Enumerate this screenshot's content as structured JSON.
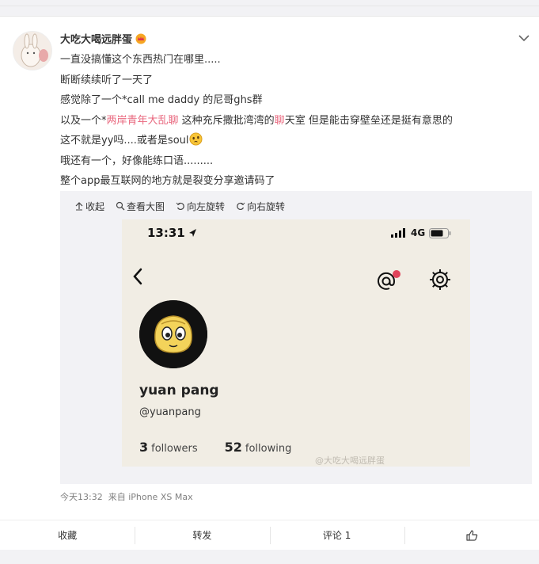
{
  "post": {
    "username": "大吃大喝远胖蛋",
    "lines": [
      "一直没搞懂这个东西热门在哪里.....",
      "断断续续听了一天了",
      "感觉除了一个*call me daddy 的尼哥ghs群"
    ],
    "line4": {
      "a": "以及一个*",
      "b": "两岸青年大乱聊",
      "c": " 这种充斥撒批湾湾的",
      "d": "聊",
      "e": "天室 但是能击穿壁垒还是挺有意思的"
    },
    "line5": "这不就是yy吗....或者是soul",
    "line6": "哦还有一个，好像能练口语.........",
    "line7": "整个app最互联网的地方就是裂变分享邀请码了",
    "timestamp": "今天13:32",
    "source": "来自 iPhone XS Max"
  },
  "media_toolbar": {
    "collapse": "收起",
    "view_large": "查看大图",
    "rotate_left": "向左旋转",
    "rotate_right": "向右旋转"
  },
  "screenshot": {
    "time": "13:31",
    "network": "4G",
    "profile_name": "yuan pang",
    "handle": "@yuanpang",
    "followers_count": "3",
    "followers_label": "followers",
    "following_count": "52",
    "following_label": "following",
    "watermark": "@大吃大喝远胖蛋"
  },
  "actions": {
    "favorite": "收藏",
    "repost": "转发",
    "comment": "评论 1"
  },
  "colors": {
    "highlight": "#e9677e",
    "notification_dot": "#e0435a"
  },
  "icons": [
    "chevron-down-icon",
    "crown-icon",
    "emoji-icon",
    "collapse-icon",
    "magnifier-icon",
    "rotate-left-icon",
    "rotate-right-icon",
    "signal-icon",
    "battery-icon",
    "back-icon",
    "mention-icon",
    "gear-icon",
    "like-icon"
  ]
}
